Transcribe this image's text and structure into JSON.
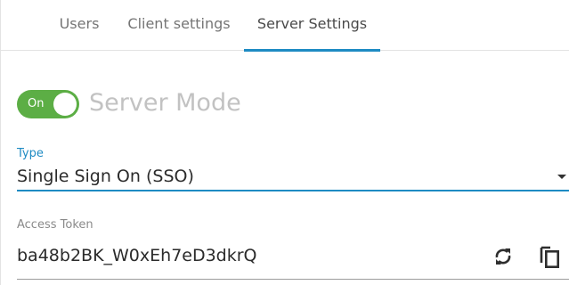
{
  "tabs": [
    {
      "label": "Users",
      "active": false
    },
    {
      "label": "Client settings",
      "active": false
    },
    {
      "label": "Server Settings",
      "active": true
    }
  ],
  "server_mode": {
    "toggle_label": "On",
    "enabled": true,
    "title": "Server Mode"
  },
  "type_field": {
    "label": "Type",
    "value": "Single Sign On (SSO)"
  },
  "access_token": {
    "label": "Access Token",
    "value": "ba48b2BK_W0xEh7eD3dkrQ",
    "icons": [
      "refresh-icon",
      "copy-icon"
    ]
  },
  "colors": {
    "accent": "#1e8bc3",
    "toggle_on": "#5cae45",
    "muted_title": "#c2c2c2"
  }
}
